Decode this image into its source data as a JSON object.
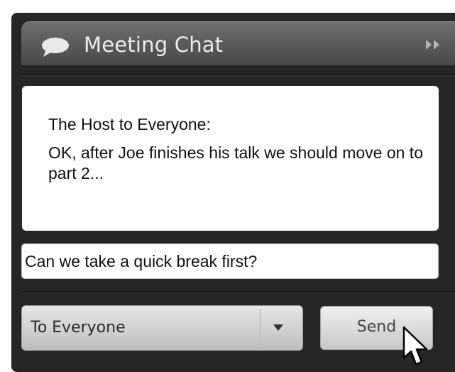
{
  "header": {
    "title": "Meeting Chat",
    "icon": "speech-bubble-icon",
    "expand_icon": "double-chevron-right-icon"
  },
  "messages": [
    {
      "sender": "The Host to Everyone:",
      "text": "OK, after Joe finishes his talk we should move on to part 2..."
    }
  ],
  "compose": {
    "value": "Can we take a quick break first?"
  },
  "recipient": {
    "selected": "To Everyone",
    "icon": "chevron-down-icon"
  },
  "send": {
    "label": "Send"
  },
  "colors": {
    "panel": "#262626",
    "header": "#5c5c5c",
    "title_text": "#ececec"
  }
}
